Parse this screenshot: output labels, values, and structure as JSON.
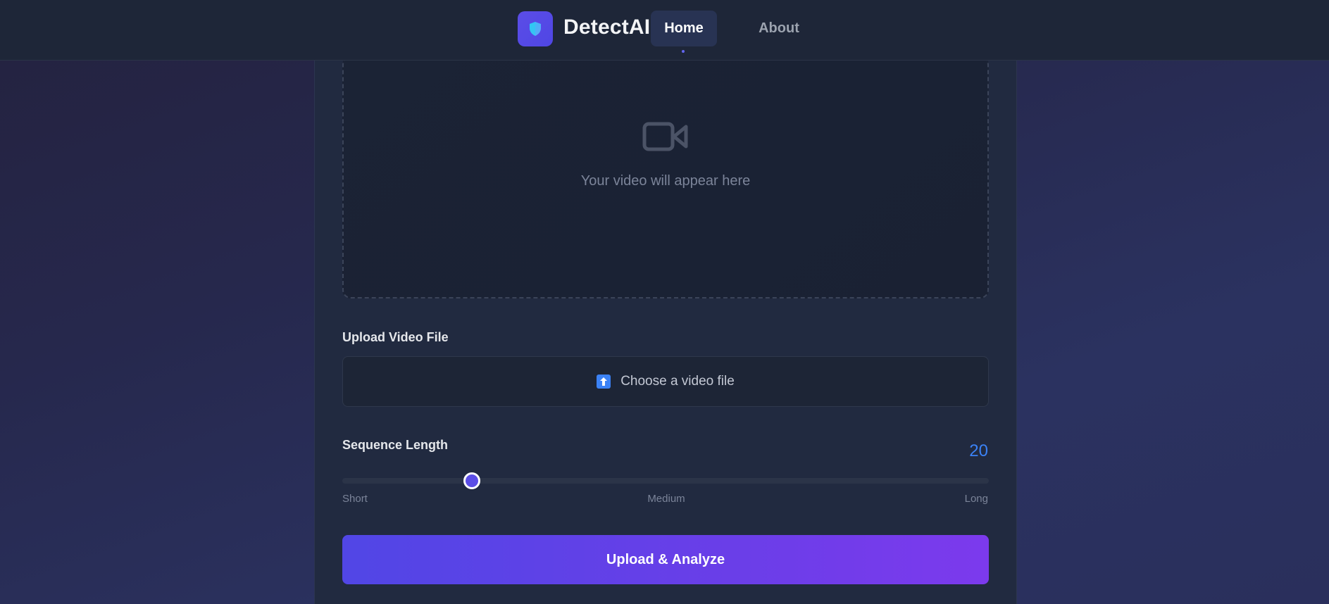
{
  "brand": {
    "name": "DetectAI",
    "logo_icon": "shield-icon",
    "accent": "#4f46e5"
  },
  "nav": {
    "items": [
      {
        "label": "Home",
        "active": true
      },
      {
        "label": "About",
        "active": false
      }
    ]
  },
  "video_preview": {
    "icon": "video-camera-icon",
    "placeholder": "Your video will appear here"
  },
  "upload": {
    "label": "Upload Video File",
    "button_icon": "upload-arrow-icon",
    "button_text": "Choose a video file"
  },
  "sequence": {
    "label": "Sequence Length",
    "value": "20",
    "level": 0.2,
    "ticks": {
      "short": "Short",
      "medium": "Medium",
      "long": "Long"
    }
  },
  "actions": {
    "analyze_label": "Upload & Analyze"
  },
  "colors": {
    "accent_blue": "#3b82f6",
    "button_gradient_start": "#5146e6",
    "button_gradient_end": "#7c3aed"
  }
}
